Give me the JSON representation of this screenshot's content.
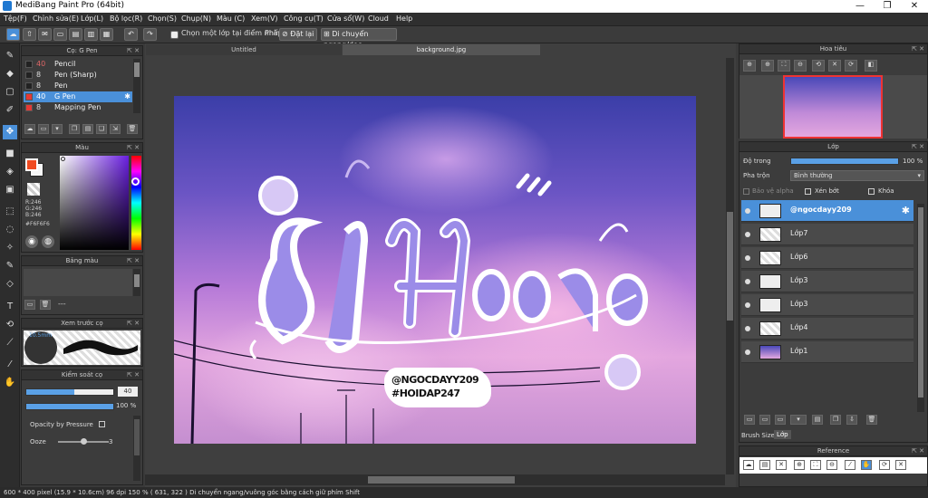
{
  "window": {
    "title": "MediBang Paint Pro (64bit)",
    "minimize": "—",
    "maximize": "❐",
    "close": "✕"
  },
  "menu": [
    "Tệp(F)",
    "Chỉnh sửa(E)",
    "Lớp(L)",
    "Bộ lọc(R)",
    "Chọn(S)",
    "Chụp(N)",
    "Màu (C)",
    "Xem(V)",
    "Công cụ(T)",
    "Cửa sổ(W)",
    "Cloud",
    "Help"
  ],
  "toolbar": {
    "select_one_layer": "Chọn một lớp tại điểm nhấp",
    "keys_label": "Phím",
    "reset": "Đặt lại",
    "move_hint": "Di chuyển ngang/dọc"
  },
  "brush_panel": {
    "title": "Cọ: G Pen",
    "items": [
      {
        "size": "40",
        "name": "Pencil",
        "color": "#222222"
      },
      {
        "size": "8",
        "name": "Pen (Sharp)",
        "color": "#222222"
      },
      {
        "size": "8",
        "name": "Pen",
        "color": "#222222"
      },
      {
        "size": "40",
        "name": "G Pen",
        "color": "#e53935"
      },
      {
        "size": "8",
        "name": "Mapping Pen",
        "color": "#e53935"
      }
    ]
  },
  "color_panel": {
    "title": "Màu",
    "r": "R:246",
    "g": "G:246",
    "b": "B:246",
    "hex": "#F6F6F6",
    "fg": "#f04a20",
    "bg": "#f6f6f6"
  },
  "palette_panel": {
    "title": "Bảng màu",
    "separator": "---"
  },
  "preview_panel": {
    "title": "Xem trước cọ",
    "size": "10.5mm"
  },
  "control_panel": {
    "title": "Kiểm soát cọ",
    "size_value": "40",
    "size_fraction": 0.55,
    "opacity_value": "100 %",
    "opacity_fraction": 1.0,
    "opacity_by_pressure": "Opacity by Pressure",
    "ooze_label": "Ooze",
    "ooze_value": "3",
    "ooze_fraction": 0.5
  },
  "document": {
    "tabs": [
      "Untitled",
      "background.jpg"
    ],
    "watermark_line1": "@NGOCDAYY209",
    "watermark_line2": "#HOIDAP247"
  },
  "navigator_panel": {
    "title": "Hoa tiêu"
  },
  "layer_panel": {
    "title": "Lớp",
    "opacity_label": "Độ trong",
    "opacity_value": "100 %",
    "opacity_fraction": 1.0,
    "blend_label": "Pha trộn",
    "blend_value": "Bình thường",
    "protect_alpha": "Bảo vệ alpha",
    "clipping": "Xén bớt",
    "lock": "Khóa",
    "layers": [
      {
        "name": "@ngocdayy209",
        "selected": true
      },
      {
        "name": "Lớp7",
        "selected": false
      },
      {
        "name": "Lớp6",
        "selected": false
      },
      {
        "name": "Lớp3",
        "selected": false
      },
      {
        "name": "Lớp3",
        "selected": false
      },
      {
        "name": "Lớp4",
        "selected": false
      },
      {
        "name": "Lớp1",
        "selected": false
      }
    ],
    "tabs": [
      "Brush Size",
      "Lớp"
    ]
  },
  "reference_panel": {
    "title": "Reference"
  },
  "status": "600 * 400 pixel   (15.9 * 10.6cm)   96 dpi   150 %   ( 631, 322 )   Di chuyển ngang/vuông góc bằng cách giữ phím Shift"
}
